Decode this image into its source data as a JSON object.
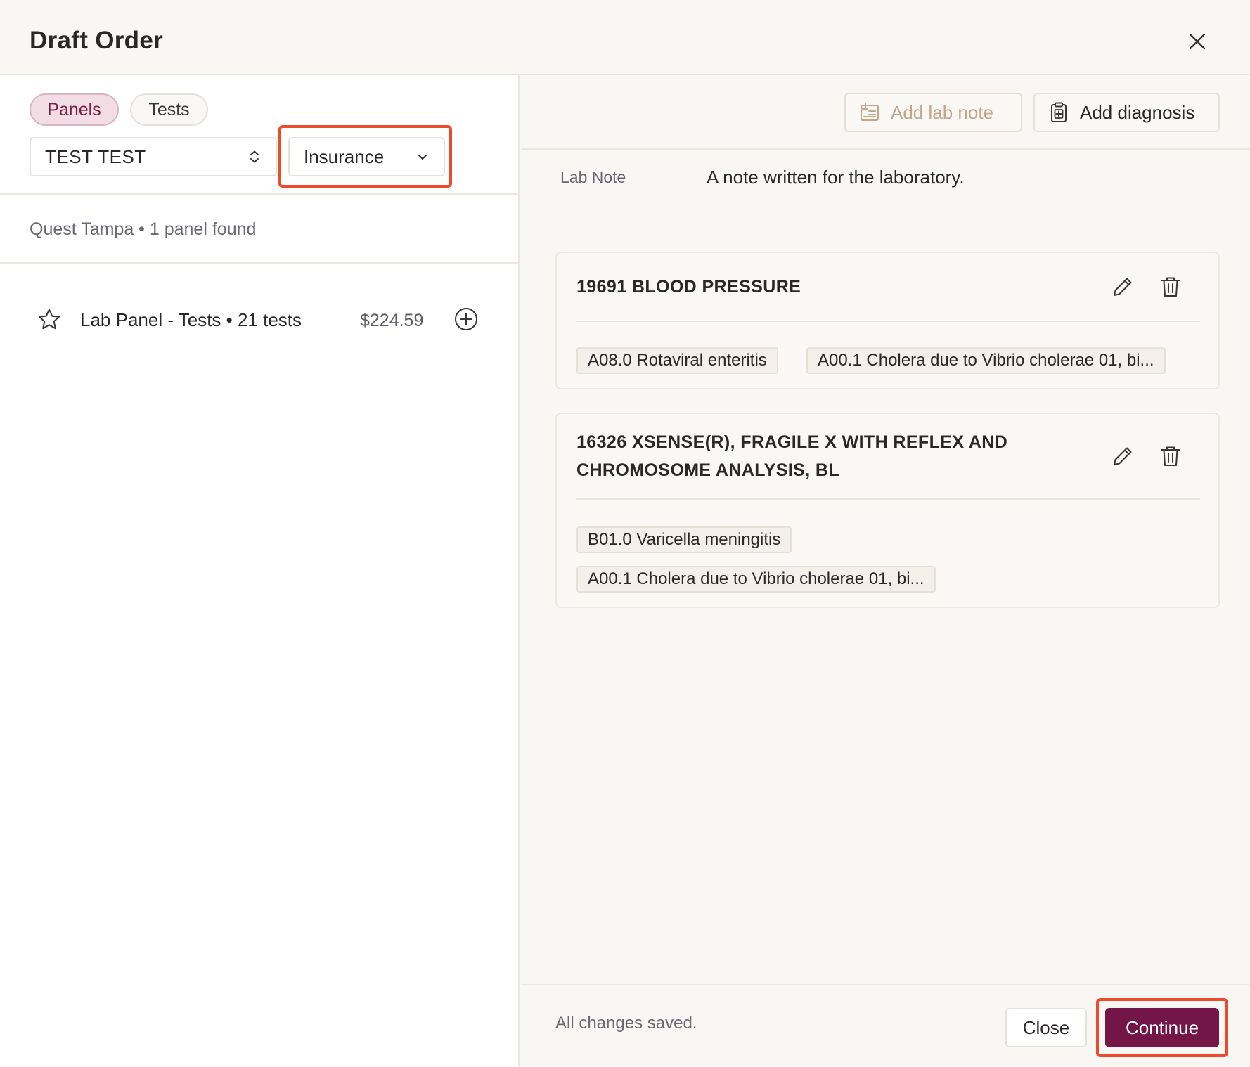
{
  "modal": {
    "title": "Draft Order"
  },
  "left": {
    "tabs": [
      {
        "label": "Panels",
        "active": true
      },
      {
        "label": "Tests",
        "active": false
      }
    ],
    "patient_select": {
      "value": "TEST TEST"
    },
    "billing_select": {
      "value": "Insurance"
    },
    "lab_info": "Quest Tampa • 1 panel found",
    "panels": [
      {
        "name": "Lab Panel - Tests • 21 tests",
        "price": "$224.59"
      }
    ]
  },
  "right": {
    "add_lab_note_label": "Add lab note",
    "add_diagnosis_label": "Add diagnosis",
    "lab_note": {
      "label": "Lab Note",
      "text": "A note written for the laboratory."
    },
    "orders": [
      {
        "title_line1": "19691 BLOOD PRESSURE",
        "title_line2": "",
        "diagnoses": [
          "A08.0 Rotaviral enteritis",
          "A00.1 Cholera due to Vibrio cholerae 01, bi..."
        ]
      },
      {
        "title_line1": "16326 XSENSE(R), FRAGILE X WITH REFLEX AND",
        "title_line2": "CHROMOSOME ANALYSIS, BL",
        "diagnoses": [
          "B01.0 Varicella meningitis",
          "A00.1 Cholera due to Vibrio cholerae 01, bi..."
        ]
      }
    ],
    "footer": {
      "status": "All changes saved.",
      "close_label": "Close",
      "continue_label": "Continue"
    }
  },
  "colors": {
    "primary": "#741547",
    "highlight": "#ec4b2c",
    "active_tab_bg": "#f2dde5"
  },
  "icons": [
    "close-icon",
    "chevron-up-down-icon",
    "chevron-down-icon",
    "star-icon",
    "plus-circle-icon",
    "note-icon",
    "clipboard-plus-icon",
    "pencil-icon",
    "trash-icon"
  ]
}
